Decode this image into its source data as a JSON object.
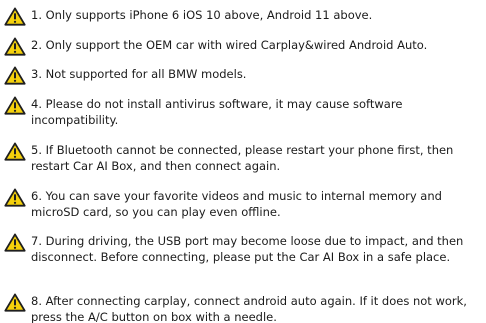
{
  "notes": [
    {
      "icon": "warning-icon",
      "text": "1. Only supports iPhone 6 iOS 10 above, Android 11 above."
    },
    {
      "icon": "warning-icon",
      "text": "2. Only support the OEM car with wired Carplay&wired Android Auto."
    },
    {
      "icon": "warning-icon",
      "text": "3. Not supported for all BMW models."
    },
    {
      "icon": "warning-icon",
      "text": "4. Please do not install antivirus software, it may cause software incompatibility."
    },
    {
      "icon": "warning-icon",
      "text": "5. If Bluetooth cannot be connected, please restart your phone first, then restart Car AI Box, and then connect again."
    },
    {
      "icon": "warning-icon",
      "text": "6. You can save your favorite videos and music to internal memory and microSD card, so you can play even offline."
    },
    {
      "icon": "warning-icon",
      "text": "7. During driving, the USB port may become loose due to impact, and then disconnect. Before connecting, please put the Car AI Box in a safe place."
    },
    {
      "icon": "warning-icon",
      "text": "8. After connecting carplay, connect android auto again. If it does not work, press the A/C button on box with a needle."
    }
  ],
  "colors": {
    "warning_fill": "#f5d10c",
    "warning_stroke": "#1f1f1f",
    "text": "#1b1b1b"
  }
}
